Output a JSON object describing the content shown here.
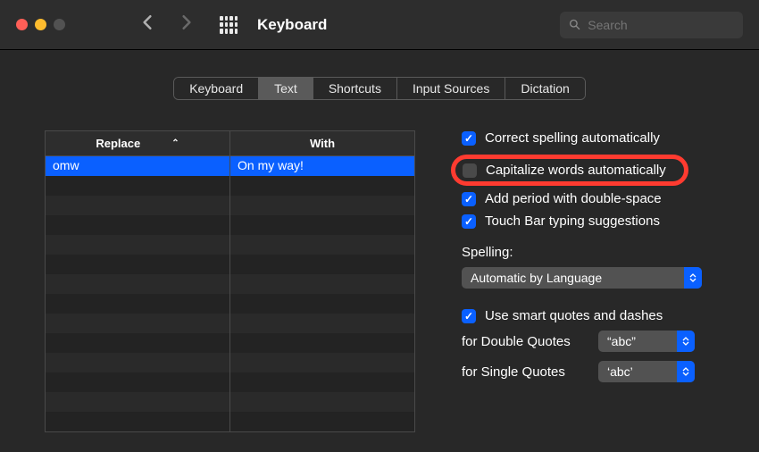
{
  "window": {
    "title": "Keyboard"
  },
  "search": {
    "placeholder": "Search"
  },
  "tabs": [
    {
      "label": "Keyboard",
      "active": false
    },
    {
      "label": "Text",
      "active": true
    },
    {
      "label": "Shortcuts",
      "active": false
    },
    {
      "label": "Input Sources",
      "active": false
    },
    {
      "label": "Dictation",
      "active": false
    }
  ],
  "table": {
    "headers": {
      "replace": "Replace",
      "with": "With"
    },
    "rows": [
      {
        "replace": "omw",
        "with": "On my way!",
        "selected": true
      }
    ]
  },
  "options": {
    "correct_spelling": "Correct spelling automatically",
    "capitalize": "Capitalize words automatically",
    "add_period": "Add period with double-space",
    "touch_bar": "Touch Bar typing suggestions",
    "spelling_label": "Spelling:",
    "spelling_value": "Automatic by Language",
    "smart_quotes": "Use smart quotes and dashes",
    "double_quotes_label": "for Double Quotes",
    "double_quotes_value": "“abc”",
    "single_quotes_label": "for Single Quotes",
    "single_quotes_value": "‘abc’"
  }
}
